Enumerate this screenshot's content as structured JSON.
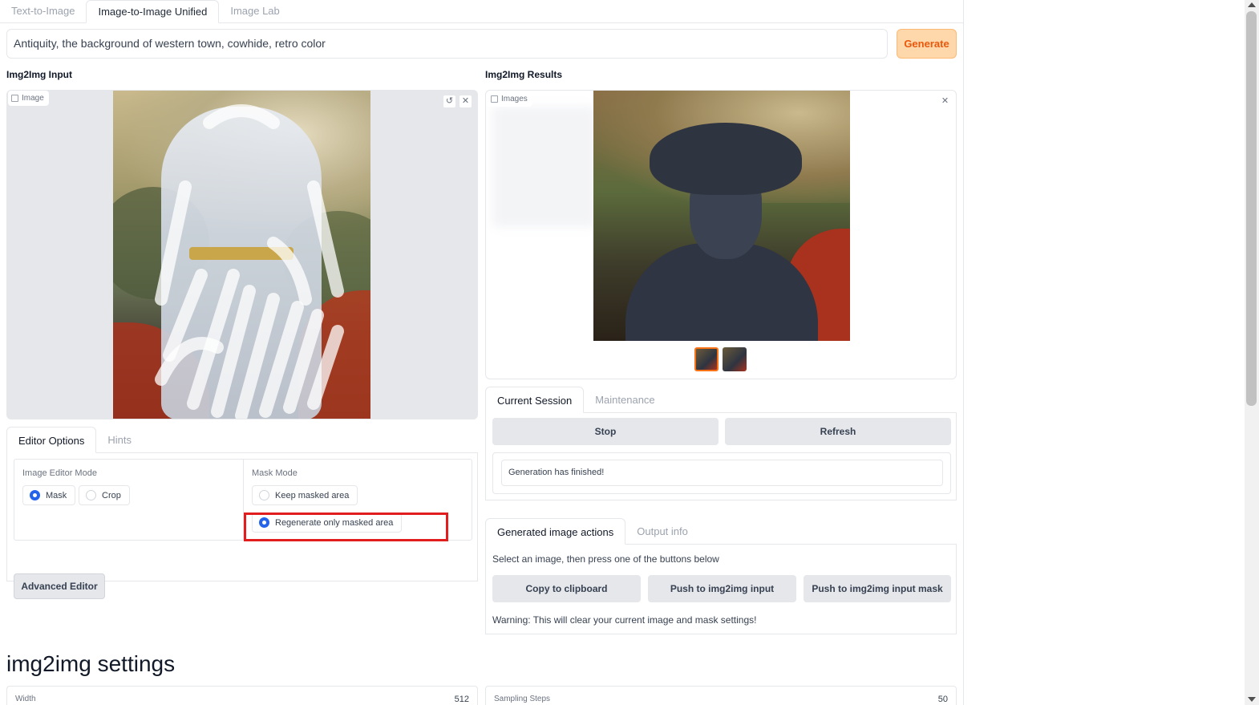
{
  "tabs": [
    {
      "label": "Text-to-Image"
    },
    {
      "label": "Image-to-Image Unified"
    },
    {
      "label": "Image Lab"
    }
  ],
  "prompt": {
    "value": "Antiquity, the background of western town, cowhide, retro color"
  },
  "generate_label": "Generate",
  "input": {
    "section_label": "Img2Img Input",
    "badge_label": "Image",
    "badge_icon": "image-icon",
    "undo_icon": "undo-icon",
    "close_icon": "close-icon"
  },
  "results": {
    "section_label": "Img2Img Results",
    "badge_label": "Images",
    "badge_icon": "image-icon",
    "close_icon": "close-icon"
  },
  "editor_tabs": [
    {
      "label": "Editor Options"
    },
    {
      "label": "Hints"
    }
  ],
  "editor": {
    "mode_title": "Image Editor Mode",
    "mode_options": [
      {
        "label": "Mask",
        "checked": true
      },
      {
        "label": "Crop",
        "checked": false
      }
    ],
    "mask_title": "Mask Mode",
    "mask_options": [
      {
        "label": "Keep masked area",
        "checked": false
      },
      {
        "label": "Regenerate only masked area",
        "checked": true
      }
    ],
    "advanced_label": "Advanced Editor"
  },
  "session_tabs": [
    {
      "label": "Current Session"
    },
    {
      "label": "Maintenance"
    }
  ],
  "session": {
    "stop_label": "Stop",
    "refresh_label": "Refresh",
    "status": "Generation has finished!"
  },
  "action_tabs": [
    {
      "label": "Generated image actions"
    },
    {
      "label": "Output info"
    }
  ],
  "actions": {
    "hint": "Select an image, then press one of the buttons below",
    "copy_label": "Copy to clipboard",
    "push_input_label": "Push to img2img input",
    "push_mask_label": "Push to img2img input mask",
    "warning": "Warning: This will clear your current image and mask settings!"
  },
  "settings": {
    "title": "img2img settings",
    "width_label": "Width",
    "width_value": "512",
    "steps_label": "Sampling Steps",
    "steps_value": "50"
  },
  "colors": {
    "accent": "#f97316",
    "generate_bg": "#fed7aa",
    "highlight": "#e11d1d",
    "radio_checked": "#2563eb"
  }
}
